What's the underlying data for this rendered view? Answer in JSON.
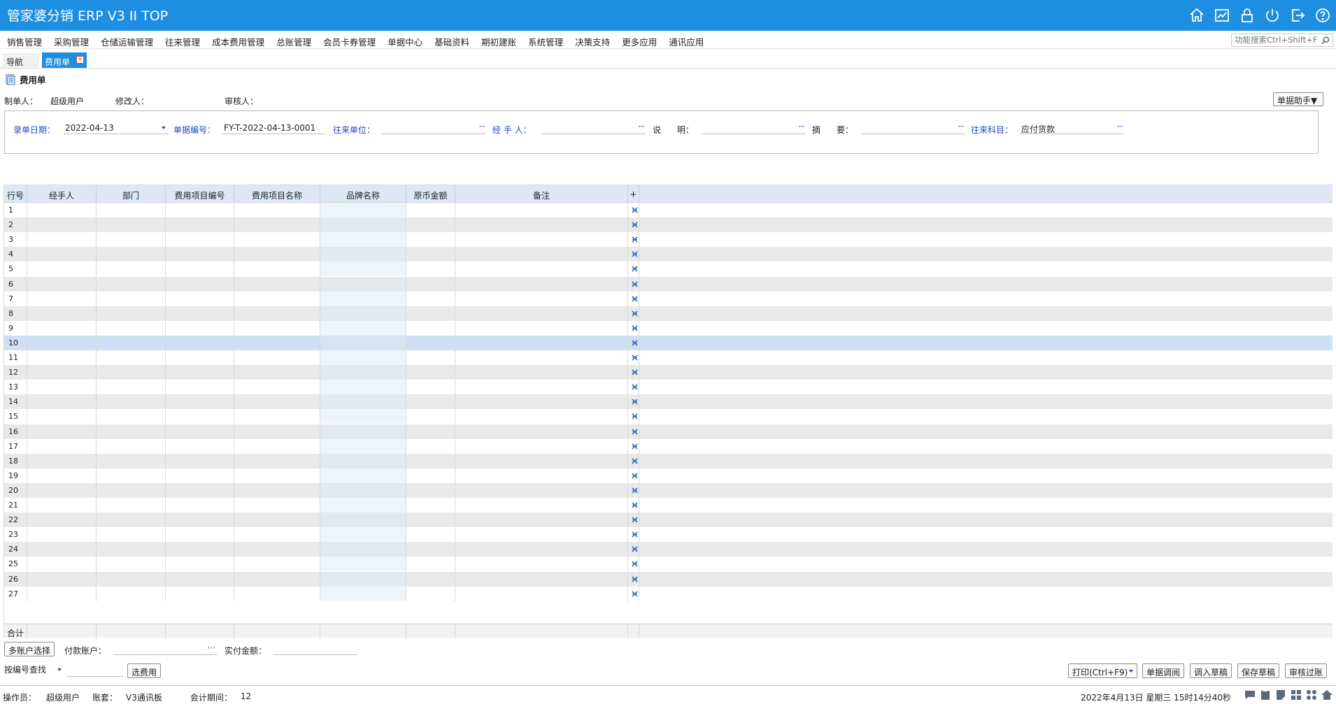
{
  "app": {
    "title": "管家婆分销 ERP V3 II TOP",
    "top_icons": [
      "home-icon",
      "chart-icon",
      "lock-icon",
      "power-icon",
      "logout-icon",
      "help-icon"
    ]
  },
  "menu": {
    "items": [
      "销售管理",
      "采购管理",
      "仓储运输管理",
      "往来管理",
      "成本费用管理",
      "总账管理",
      "会员卡券管理",
      "单据中心",
      "基础资料",
      "期初建账",
      "系统管理",
      "决策支持",
      "更多应用",
      "通讯应用"
    ],
    "search_placeholder": "功能搜索Ctrl+Shift+F"
  },
  "tabs": {
    "nav": "导航",
    "active": "费用单"
  },
  "doc": {
    "title": "费用单",
    "creator_label": "制单人：",
    "creator": "超级用户",
    "modifier_label": "修改人：",
    "reviewer_label": "审核人：",
    "assistant_button": "单据助手▼"
  },
  "form": {
    "date_label": "录单日期：",
    "date_value": "2022-04-13",
    "number_label": "单据编号：",
    "number_value": "FY-T-2022-04-13-0001",
    "partner_label": "往来单位：",
    "partner_value": "",
    "handler_label": "经 手 人：",
    "handler_value": "",
    "desc_label1": "说",
    "desc_label2": "明：",
    "desc_value": "",
    "summary_label1": "摘",
    "summary_label2": "要：",
    "summary_value": "",
    "account_label": "往来科目：",
    "account_value": "应付货款",
    "dots": "···"
  },
  "grid": {
    "columns": [
      "行号",
      "经手人",
      "部门",
      "费用项目编号",
      "费用项目名称",
      "品牌名称",
      "原币金额",
      "备注",
      "+"
    ],
    "rows": [
      "1",
      "2",
      "3",
      "4",
      "5",
      "6",
      "7",
      "8",
      "9",
      "10",
      "11",
      "12",
      "13",
      "14",
      "15",
      "16",
      "17",
      "18",
      "19",
      "20",
      "21",
      "22",
      "23",
      "24",
      "25",
      "26",
      "27"
    ],
    "selected_row": "10",
    "total_label": "合计"
  },
  "bottom": {
    "multi_account_button": "多账户选择",
    "pay_account_label": "付款账户：",
    "pay_account_value": "",
    "actual_amount_label": "实付金额：",
    "actual_amount_value": "",
    "search_mode": "按编号查找",
    "select_fee_button": "选费用",
    "print_button": "打印(Ctrl+F9)",
    "doc_adjust_button": "单据调阅",
    "load_draft_button": "调入草稿",
    "save_draft_button": "保存草稿",
    "post_button": "审核过账"
  },
  "status": {
    "operator_label": "操作员：",
    "operator": "超级用户",
    "book_label": "账套：",
    "book": "V3通讯板",
    "period_label": "会计期间：",
    "period": "12",
    "datetime": "2022年4月13日  星期三  15时14分40秒"
  }
}
